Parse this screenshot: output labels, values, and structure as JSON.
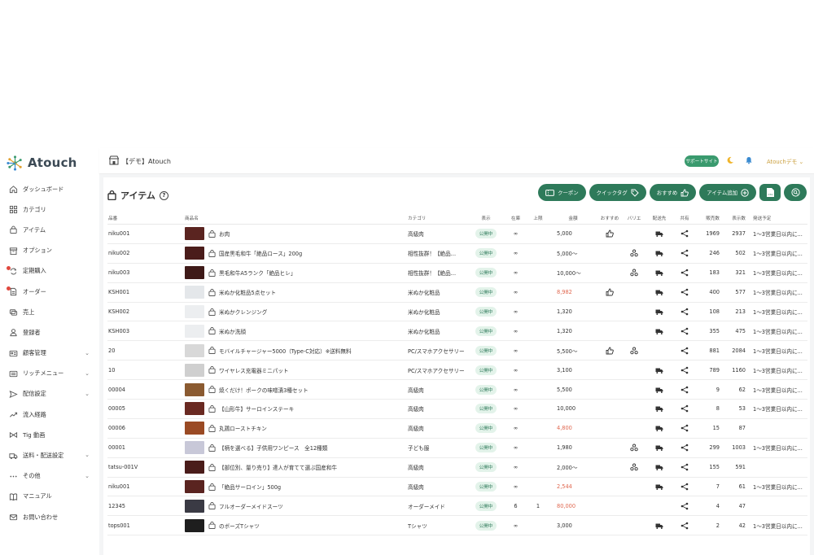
{
  "brand": {
    "name": "Atouch",
    "colors": {
      "accent": "#2e7a5a",
      "badge_bg": "#e3f3ea",
      "sale_red": "#e06850",
      "support": "#3a9a6e",
      "user": "#c99d3a"
    }
  },
  "sidebar": {
    "items": [
      {
        "label": "ダッシュボード",
        "icon": "home-icon",
        "chevron": false,
        "dot": false
      },
      {
        "label": "カテゴリ",
        "icon": "grid-icon",
        "chevron": false,
        "dot": false
      },
      {
        "label": "アイテム",
        "icon": "bag-icon",
        "chevron": false,
        "dot": false
      },
      {
        "label": "オプション",
        "icon": "box-icon",
        "chevron": false,
        "dot": false
      },
      {
        "label": "定期購入",
        "icon": "repeat-icon",
        "chevron": false,
        "dot": true
      },
      {
        "label": "オーダー",
        "icon": "document-icon",
        "chevron": false,
        "dot": true
      },
      {
        "label": "売上",
        "icon": "coins-icon",
        "chevron": false,
        "dot": false
      },
      {
        "label": "登録者",
        "icon": "user-icon",
        "chevron": false,
        "dot": false
      },
      {
        "label": "顧客管理",
        "icon": "id-card-icon",
        "chevron": true,
        "dot": false
      },
      {
        "label": "リッチメニュー",
        "icon": "menu-card-icon",
        "chevron": true,
        "dot": false
      },
      {
        "label": "配信設定",
        "icon": "send-icon",
        "chevron": true,
        "dot": false
      },
      {
        "label": "流入経路",
        "icon": "trend-icon",
        "chevron": false,
        "dot": false
      },
      {
        "label": "Tig 動画",
        "icon": "bowtie-icon",
        "chevron": false,
        "dot": false
      },
      {
        "label": "送料・配送設定",
        "icon": "truck-icon",
        "chevron": true,
        "dot": false
      },
      {
        "label": "その他",
        "icon": "more-icon",
        "chevron": true,
        "dot": false
      },
      {
        "label": "マニュアル",
        "icon": "book-icon",
        "chevron": false,
        "dot": false
      },
      {
        "label": "お問い合わせ",
        "icon": "mail-icon",
        "chevron": false,
        "dot": false
      }
    ]
  },
  "header": {
    "store_name": "【デモ】Atouch",
    "support_label": "サポートサイト",
    "user_label": "Atouchデモ ⌄"
  },
  "page": {
    "title": "アイテム",
    "help": "?",
    "actions": {
      "coupon": "クーポン",
      "quick_tag": "クイックタグ",
      "recommend": "おすすめ",
      "add_item": "アイテム追加",
      "csv": "CSV"
    }
  },
  "table": {
    "headers": {
      "code": "品番",
      "name": "商品名",
      "category": "カテゴリ",
      "show": "表示",
      "stock": "在庫",
      "max": "上限",
      "price": "金額",
      "recommend": "おすすめ",
      "variation": "バリエ",
      "shipping": "配送先",
      "share": "共有",
      "sold": "販売数",
      "views": "表示数",
      "schedule": "発送予定"
    },
    "rows": [
      {
        "code": "niku001",
        "name": "お肉",
        "thumb": "#5a2420",
        "category": "高級肉",
        "status": "公開中",
        "stock": "∞",
        "max": "",
        "price": "5,000",
        "price_red": false,
        "rec": true,
        "var": false,
        "ship": true,
        "sold": "1969",
        "views": "2937",
        "schedule": "1〜3営業日以内に..."
      },
      {
        "code": "niku002",
        "name": "国産黒毛和牛「絶品ロース」200g",
        "thumb": "#4a1c1a",
        "category": "相性抜群！【絶品...",
        "status": "公開中",
        "stock": "∞",
        "max": "",
        "price": "5,000〜",
        "price_red": false,
        "rec": false,
        "var": true,
        "ship": true,
        "sold": "246",
        "views": "502",
        "schedule": "1〜3営業日以内に..."
      },
      {
        "code": "niku003",
        "name": "黒毛和牛A5ランク「絶品ヒレ」",
        "thumb": "#3e1a18",
        "category": "相性抜群！【絶品...",
        "status": "公開中",
        "stock": "∞",
        "max": "",
        "price": "10,000〜",
        "price_red": false,
        "rec": false,
        "var": true,
        "ship": true,
        "sold": "183",
        "views": "321",
        "schedule": "1〜3営業日以内に..."
      },
      {
        "code": "KSH001",
        "name": "米ぬか化粧品5点セット",
        "thumb": "#e4e7ea",
        "category": "米ぬか化粧品",
        "status": "公開中",
        "stock": "∞",
        "max": "",
        "price": "8,982",
        "price_red": true,
        "rec": true,
        "var": false,
        "ship": true,
        "sold": "400",
        "views": "577",
        "schedule": "1〜3営業日以内に..."
      },
      {
        "code": "KSH002",
        "name": "米ぬかクレンジング",
        "thumb": "#eceef0",
        "category": "米ぬか化粧品",
        "status": "公開中",
        "stock": "∞",
        "max": "",
        "price": "1,320",
        "price_red": false,
        "rec": false,
        "var": false,
        "ship": true,
        "sold": "108",
        "views": "213",
        "schedule": "1〜3営業日以内に..."
      },
      {
        "code": "KSH003",
        "name": "米ぬか洗顔",
        "thumb": "#eceef0",
        "category": "米ぬか化粧品",
        "status": "公開中",
        "stock": "∞",
        "max": "",
        "price": "1,320",
        "price_red": false,
        "rec": false,
        "var": false,
        "ship": true,
        "sold": "355",
        "views": "475",
        "schedule": "1〜3営業日以内に..."
      },
      {
        "code": "20",
        "name": "モバイルチャージャー5000（Type-C対応）※送料無料",
        "thumb": "#d8d8d8",
        "category": "PC/スマホアクセサリー",
        "status": "公開中",
        "stock": "∞",
        "max": "",
        "price": "5,500〜",
        "price_red": false,
        "rec": true,
        "var": true,
        "ship": false,
        "sold": "881",
        "views": "2084",
        "schedule": "1〜3営業日以内に..."
      },
      {
        "code": "10",
        "name": "ワイヤレス充電器ミニパット",
        "thumb": "#cfcfcf",
        "category": "PC/スマホアクセサリー",
        "status": "公開中",
        "stock": "∞",
        "max": "",
        "price": "3,100",
        "price_red": false,
        "rec": false,
        "var": false,
        "ship": true,
        "sold": "789",
        "views": "1160",
        "schedule": "1〜3営業日以内に..."
      },
      {
        "code": "00004",
        "name": "焼くだけ！ポークの味噌漬3種セット",
        "thumb": "#8a5a30",
        "category": "高級肉",
        "status": "公開中",
        "stock": "∞",
        "max": "",
        "price": "5,500",
        "price_red": false,
        "rec": false,
        "var": false,
        "ship": true,
        "sold": "9",
        "views": "62",
        "schedule": "1〜3営業日以内に..."
      },
      {
        "code": "00005",
        "name": "【山形牛】サーロインステーキ",
        "thumb": "#6a2a22",
        "category": "高級肉",
        "status": "公開中",
        "stock": "∞",
        "max": "",
        "price": "10,000",
        "price_red": false,
        "rec": false,
        "var": false,
        "ship": true,
        "sold": "8",
        "views": "53",
        "schedule": "1〜3営業日以内に..."
      },
      {
        "code": "00006",
        "name": "丸鶏ローストチキン",
        "thumb": "#9a4a24",
        "category": "高級肉",
        "status": "公開中",
        "stock": "∞",
        "max": "",
        "price": "4,800",
        "price_red": true,
        "rec": false,
        "var": false,
        "ship": true,
        "sold": "15",
        "views": "87",
        "schedule": ""
      },
      {
        "code": "00001",
        "name": "【柄を選べる】子供用ワンピース　全12種類",
        "thumb": "#c8c8d8",
        "category": "子ども服",
        "status": "公開中",
        "stock": "∞",
        "max": "",
        "price": "1,980",
        "price_red": false,
        "rec": false,
        "var": true,
        "ship": true,
        "sold": "299",
        "views": "1003",
        "schedule": "1〜3営業日以内に..."
      },
      {
        "code": "tatsu-001V",
        "name": "【部位別、量り売り】達人が育てて選ぶ国産和牛",
        "thumb": "#4a1c1a",
        "category": "高級肉",
        "status": "公開中",
        "stock": "∞",
        "max": "",
        "price": "2,000〜",
        "price_red": false,
        "rec": false,
        "var": true,
        "ship": true,
        "sold": "155",
        "views": "591",
        "schedule": ""
      },
      {
        "code": "niku001",
        "name": "「絶品サーロイン」500g",
        "thumb": "#5a2420",
        "category": "高級肉",
        "status": "公開中",
        "stock": "∞",
        "max": "",
        "price": "2,544",
        "price_red": true,
        "rec": false,
        "var": false,
        "ship": true,
        "sold": "7",
        "views": "61",
        "schedule": "1〜3営業日以内に..."
      },
      {
        "code": "12345",
        "name": "フルオーダーメイドスーツ",
        "thumb": "#3a3a44",
        "category": "オーダーメイド",
        "status": "公開中",
        "stock": "6",
        "max": "1",
        "price": "80,000",
        "price_red": true,
        "rec": false,
        "var": false,
        "ship": false,
        "sold": "4",
        "views": "47",
        "schedule": ""
      },
      {
        "code": "tops001",
        "name": "のボーズTシャツ",
        "thumb": "#1e1e1e",
        "category": "Tシャツ",
        "status": "公開中",
        "stock": "∞",
        "max": "",
        "price": "3,000",
        "price_red": false,
        "rec": false,
        "var": false,
        "ship": true,
        "sold": "2",
        "views": "42",
        "schedule": "1〜3営業日以内に..."
      }
    ]
  }
}
